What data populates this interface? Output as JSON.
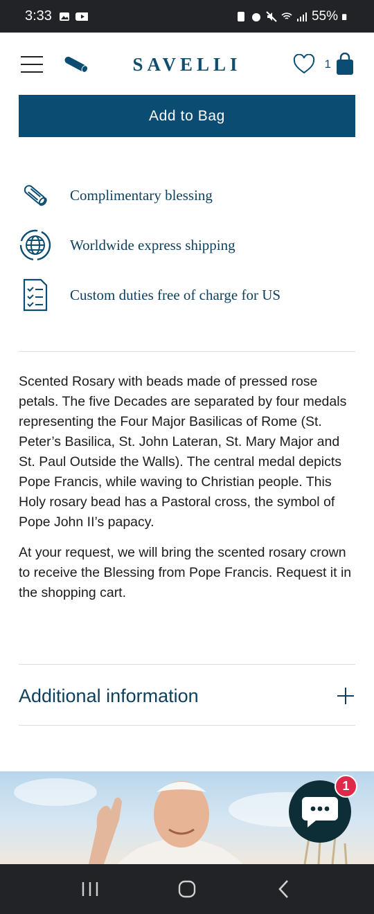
{
  "status_bar": {
    "time": "3:33",
    "battery": "55%"
  },
  "header": {
    "logo": "SAVELLI",
    "bag_count": "1"
  },
  "product": {
    "add_to_bag_label": "Add to Bag",
    "features": [
      {
        "icon": "scroll-icon",
        "label": "Complimentary blessing"
      },
      {
        "icon": "globe-icon",
        "label": "Worldwide express shipping"
      },
      {
        "icon": "checklist-icon",
        "label": "Custom duties free of charge for US"
      }
    ],
    "description": [
      "Scented Rosary with beads made of pressed rose petals. The five Decades are separated by four medals representing the Four Major Basilicas of Rome (St. Peter’s Basilica, St. John Lateran, St. Mary Major and St. Paul Outside the Walls). The central medal depicts Pope Francis, while waving to Christian people. This Holy rosary bead has a Pastoral cross, the symbol of Pope John II’s papacy.",
      "At your request, we will bring the scented rosary crown to receive the Blessing from Pope Francis. Request it in the shopping cart."
    ],
    "additional_info_label": "Additional information"
  },
  "chat": {
    "badge_count": "1"
  },
  "colors": {
    "brand": "#0a4c72",
    "chat": "#0d2e37",
    "badge": "#e0294a"
  }
}
